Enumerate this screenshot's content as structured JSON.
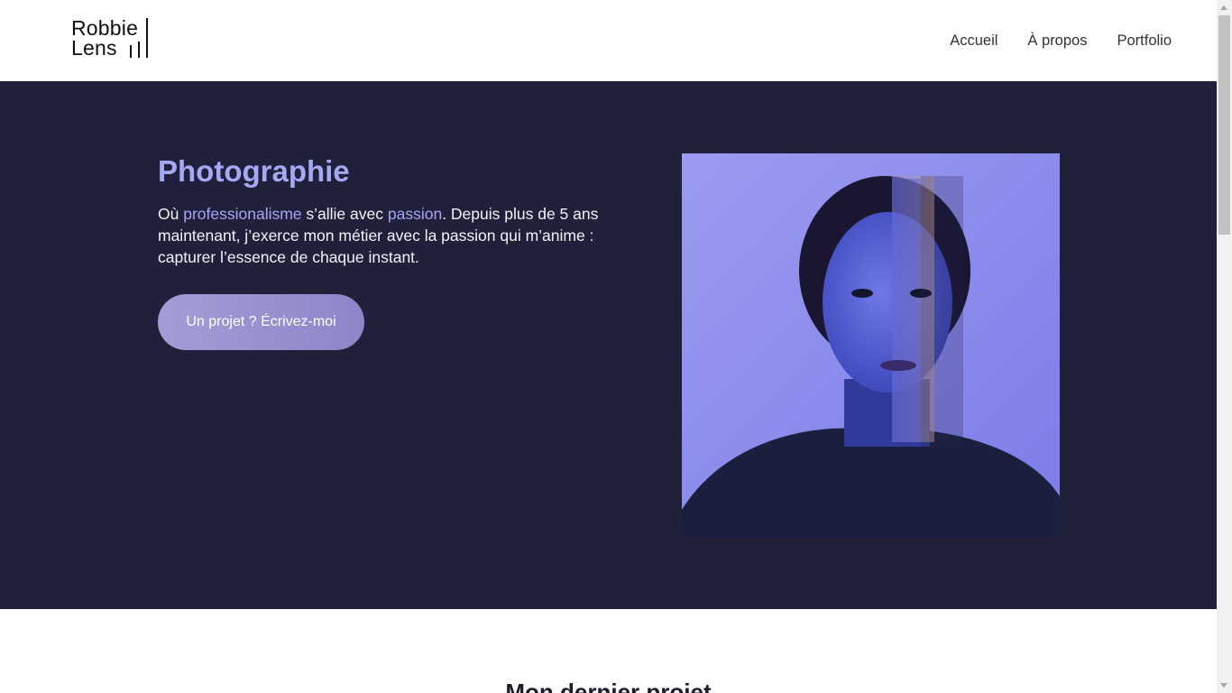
{
  "header": {
    "logo": {
      "line1": "Robbie",
      "line2": "Lens"
    },
    "nav": [
      {
        "label": "Accueil"
      },
      {
        "label": "À propos"
      },
      {
        "label": "Portfolio"
      }
    ]
  },
  "hero": {
    "title": "Photographie",
    "text": {
      "part1": "Où ",
      "highlight1": "professionalisme",
      "part2": " s’allie avec ",
      "highlight2": "passion",
      "part3": ". Depuis plus de 5 ans maintenant, j’exerce mon métier avec la passion qui m’anime : capturer l’essence de chaque instant."
    },
    "cta_label": "Un projet ? Écrivez-moi",
    "image_alt": "Portrait of a woman lit in blue and purple light"
  },
  "next_section": {
    "title": "Mon dernier projet"
  },
  "colors": {
    "hero_bg": "#21203a",
    "accent": "#a5a8f4",
    "button": "#9a95d2"
  }
}
